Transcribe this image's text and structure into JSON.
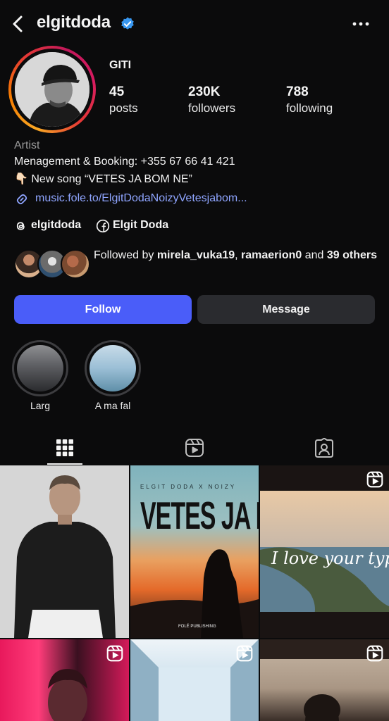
{
  "header": {
    "username": "elgitdoda",
    "back_icon": "back-arrow-icon",
    "verified_icon": "verified-badge-icon",
    "more_icon": "more-dots-icon"
  },
  "profile": {
    "display_name": "GITI",
    "stats": [
      {
        "value": "45",
        "label": "posts"
      },
      {
        "value": "230K",
        "label": "followers"
      },
      {
        "value": "788",
        "label": "following"
      }
    ],
    "category": "Artist",
    "bio_lines": [
      "Menagement & Booking: +355 67 66 41 421",
      "👇🏻 New song “VETES JA BOM NE”"
    ],
    "link": "music.fole.to/ElgitDodaNoizyVetesjabom...",
    "threads_handle": "elgitdoda",
    "facebook_name": "Elgit Doda"
  },
  "followed_by": {
    "prefix": "Followed by ",
    "user1": "mirela_vuka19",
    "separator": ", ",
    "user2": "ramaerion0",
    "middle": " and ",
    "others": "39 others"
  },
  "buttons": {
    "follow": "Follow",
    "message": "Message"
  },
  "highlights": [
    {
      "label": "Larg"
    },
    {
      "label": "A ma fal"
    }
  ],
  "tabs": [
    {
      "name": "grid",
      "icon": "grid-icon",
      "active": true
    },
    {
      "name": "reels",
      "icon": "reels-icon",
      "active": false
    },
    {
      "name": "tagged",
      "icon": "tagged-icon",
      "active": false
    }
  ],
  "posts": {
    "post2_title": "VETES JA BOM NE",
    "post2_top": "ELGIT DODA X NOIZY",
    "post2_bottom": "FOLÉ PUBLISHING",
    "post3_text": "I love your type"
  },
  "colors": {
    "accent": "#4a5df9",
    "link": "#8fa5ff",
    "background": "#0b0b0c",
    "verified": "#3897f0"
  }
}
